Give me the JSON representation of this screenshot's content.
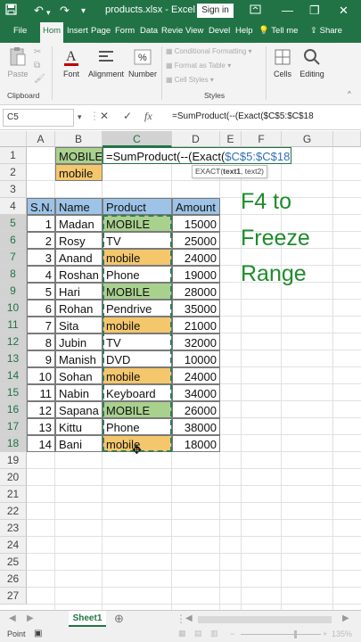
{
  "titlebar": {
    "filename": "products.xlsx",
    "dash": "-",
    "app": "Excel",
    "signin": "Sign in"
  },
  "tabs": [
    "File",
    "Hom",
    "Insert",
    "Page",
    "Form",
    "Data",
    "Revie",
    "View",
    "Devel",
    "Help"
  ],
  "tellme": "Tell me",
  "share": "Share",
  "ribbon": {
    "paste": "Paste",
    "font": "Font",
    "alignment": "Alignment",
    "number": "Number",
    "cond_format": "Conditional Formatting",
    "format_table": "Format as Table",
    "cell_styles": "Cell Styles",
    "cells": "Cells",
    "editing": "Editing",
    "clipboard_label": "Clipboard",
    "styles_label": "Styles"
  },
  "formula_bar": {
    "name_box": "C5",
    "formula": "=SumProduct(--(Exact($C$5:$C$18"
  },
  "columns": [
    "A",
    "B",
    "C",
    "D",
    "E",
    "F",
    "G"
  ],
  "rows": [
    "1",
    "2",
    "3",
    "4",
    "5",
    "6",
    "7",
    "8",
    "9",
    "10",
    "11",
    "12",
    "13",
    "14",
    "15",
    "16",
    "17",
    "18",
    "19",
    "20",
    "21",
    "22",
    "23",
    "24",
    "25",
    "26",
    "27"
  ],
  "cells": {
    "b1": "MOBILE",
    "b2": "mobile",
    "editing_black": "=SumProduct(--(Exact(",
    "editing_blue": "$C$5:$C$18",
    "tooltip_fn": "EXACT(",
    "tooltip_arg1": "text1",
    "tooltip_rest": ", text2)"
  },
  "table": {
    "headers": [
      "S.N.",
      "Name",
      "Product",
      "Amount"
    ],
    "rows": [
      {
        "sn": "1",
        "name": "Madan",
        "product": "MOBILE",
        "amount": "15000",
        "color": "green"
      },
      {
        "sn": "2",
        "name": "Rosy",
        "product": "TV",
        "amount": "25000",
        "color": ""
      },
      {
        "sn": "3",
        "name": "Anand",
        "product": "mobile",
        "amount": "24000",
        "color": "orange"
      },
      {
        "sn": "4",
        "name": "Roshan",
        "product": "Phone",
        "amount": "19000",
        "color": ""
      },
      {
        "sn": "5",
        "name": "Hari",
        "product": "MOBILE",
        "amount": "28000",
        "color": "green"
      },
      {
        "sn": "6",
        "name": "Rohan",
        "product": "Pendrive",
        "amount": "35000",
        "color": ""
      },
      {
        "sn": "7",
        "name": "Sita",
        "product": "mobile",
        "amount": "21000",
        "color": "orange"
      },
      {
        "sn": "8",
        "name": "Jubin",
        "product": "TV",
        "amount": "32000",
        "color": ""
      },
      {
        "sn": "9",
        "name": "Manish",
        "product": "DVD",
        "amount": "10000",
        "color": ""
      },
      {
        "sn": "10",
        "name": "Sohan",
        "product": "mobile",
        "amount": "24000",
        "color": "orange"
      },
      {
        "sn": "11",
        "name": "Nabin",
        "product": "Keyboard",
        "amount": "34000",
        "color": ""
      },
      {
        "sn": "12",
        "name": "Sapana",
        "product": "MOBILE",
        "amount": "26000",
        "color": "green"
      },
      {
        "sn": "13",
        "name": "Kittu",
        "product": "Phone",
        "amount": "38000",
        "color": ""
      },
      {
        "sn": "14",
        "name": "Bani",
        "product": "mobile",
        "amount": "18000",
        "color": "orange"
      }
    ]
  },
  "overlay_text": [
    "F4 to",
    "Freeze",
    "Range"
  ],
  "sheet_tab": "Sheet1",
  "status": {
    "mode": "Point",
    "zoom": "135%"
  },
  "colors": {
    "excel_green": "#217346",
    "green_fill": "#a9d18e",
    "orange_fill": "#f4c76c",
    "blue_fill": "#9dc3e6",
    "overlay_green": "#1e8c2c",
    "formula_blue": "#2f6fb6"
  }
}
